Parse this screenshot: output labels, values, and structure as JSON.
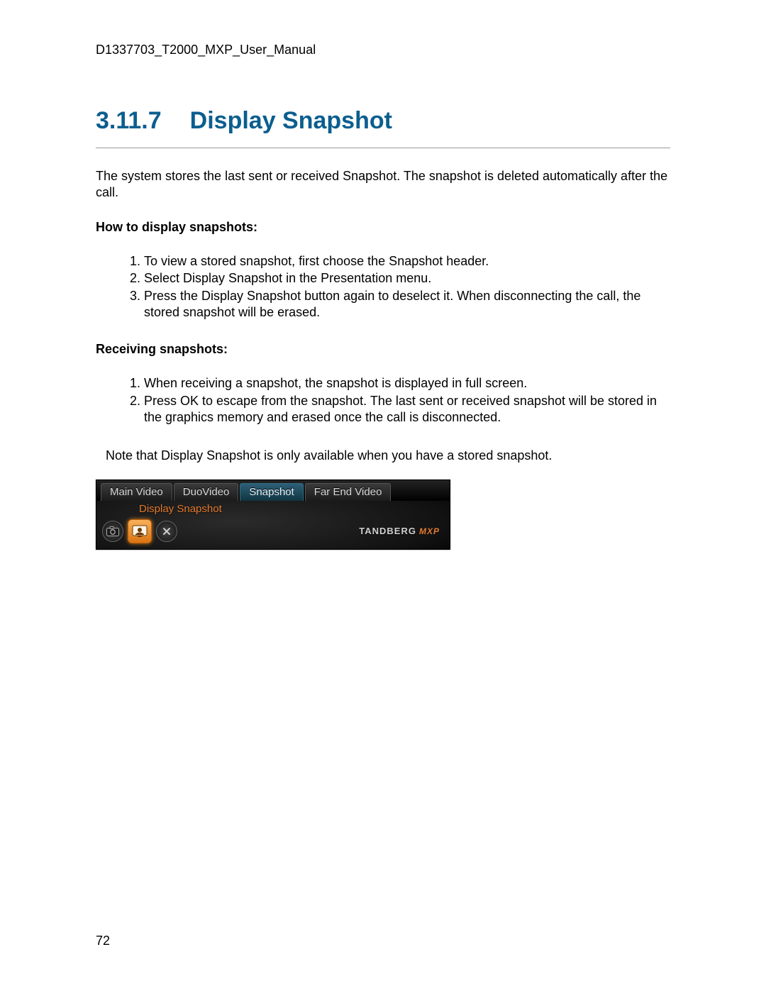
{
  "doc_header": "D1337703_T2000_MXP_User_Manual",
  "section": {
    "number": "3.11.7",
    "title": "Display Snapshot"
  },
  "intro": "The system stores the last sent or received Snapshot. The snapshot is deleted automatically after the call.",
  "how_heading": "How to display snapshots:",
  "how_steps": [
    "To view a stored snapshot, first choose the Snapshot header.",
    "Select Display Snapshot in the Presentation menu.",
    "Press the Display Snapshot button again to deselect it. When disconnecting the call, the stored snapshot will be erased."
  ],
  "recv_heading": "Receiving snapshots:",
  "recv_steps": [
    "When receiving a snapshot, the snapshot is displayed in full screen.",
    "Press OK to escape from the snapshot. The last sent or received snapshot will be stored in the graphics memory and erased once the call is disconnected."
  ],
  "note": "Note that Display Snapshot is only available when you have a stored snapshot.",
  "ui": {
    "tabs": [
      "Main Video",
      "DuoVideo",
      "Snapshot",
      "Far End Video"
    ],
    "selected_tab_index": 2,
    "sub_label": "Display Snapshot",
    "brand_main": "TANDBERG",
    "brand_suffix": "MXP"
  },
  "page_number": "72"
}
